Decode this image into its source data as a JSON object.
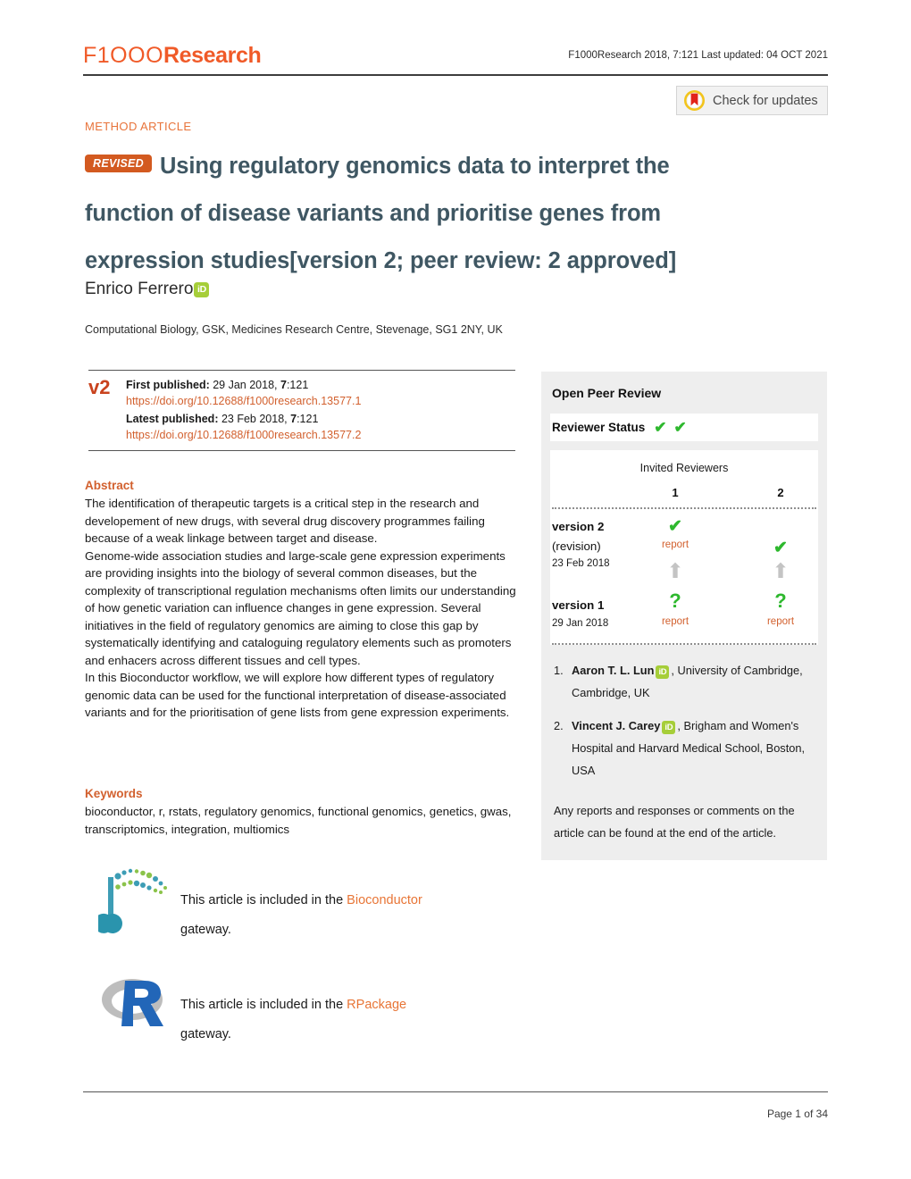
{
  "header": {
    "logo_f1000": "F1OOO",
    "logo_research": "Research",
    "citation": "F1000Research 2018, 7:121 Last updated: 04 OCT 2021",
    "crossmark_label": "Check for updates",
    "crossmark_icon": "crossmark-bookmark-icon"
  },
  "article": {
    "type": "METHOD ARTICLE",
    "revised_badge": "REVISED",
    "title_main": "Using regulatory genomics data to interpret the function of disease variants and prioritise genes from expression studies",
    "title_version": "[version 2; peer review: 2 approved]",
    "author": "Enrico Ferrero",
    "orcid_label": "iD",
    "affiliation": "Computational Biology, GSK, Medicines Research Centre, Stevenage, SG1 2NY, UK"
  },
  "publication": {
    "version_tag": "v2",
    "first_published_label": "First published:",
    "first_published_value": " 29 Jan 2018, ",
    "first_published_vol": "7",
    "first_published_page": ":121",
    "first_doi": "https://doi.org/10.12688/f1000research.13577.1",
    "latest_published_label": "Latest published:",
    "latest_published_value": " 23 Feb 2018, ",
    "latest_published_vol": "7",
    "latest_published_page": ":121",
    "latest_doi": "https://doi.org/10.12688/f1000research.13577.2"
  },
  "abstract": {
    "heading": "Abstract",
    "paragraphs": [
      "The identification of therapeutic targets is a critical step in the research and developement of new drugs, with several drug discovery programmes failing because of a weak linkage between target and disease.",
      "Genome-wide association studies and large-scale gene expression experiments are providing insights into the biology of several common diseases, but the complexity of transcriptional regulation mechanisms often limits our understanding of how genetic variation can influence changes in gene expression. Several initiatives in the field of regulatory genomics are aiming to close this gap by systematically identifying and cataloguing regulatory elements such as promoters and enhacers across different tissues and cell types.",
      "In this Bioconductor workflow, we will explore how different types of regulatory genomic data can be used for the functional interpretation of disease-associated variants and for the prioritisation of gene lists from gene expression experiments."
    ]
  },
  "keywords": {
    "heading": "Keywords",
    "text": "bioconductor, r, rstats, regulatory genomics, functional genomics, genetics, gwas, transcriptomics, integration, multiomics"
  },
  "peer_review": {
    "panel_title": "Open Peer Review",
    "status_label": "Reviewer Status",
    "status_ticks": [
      "✔",
      "✔"
    ],
    "invited_label": "Invited Reviewers",
    "columns": [
      "1",
      "2"
    ],
    "versions": [
      {
        "label": "version 2",
        "sub": "(revision)",
        "date": "23 Feb 2018"
      },
      {
        "label": "version 1",
        "sub": "",
        "date": "29 Jan 2018"
      }
    ],
    "cells": {
      "v2_r1_status": "✔",
      "v2_r1_report": "report",
      "v2_r2_status": "✔",
      "v1_r1_status": "?",
      "v1_r1_report": "report",
      "v1_r2_status": "?",
      "v1_r2_report": "report"
    },
    "reviewers": [
      {
        "num": "1.",
        "name": "Aaron T. L. Lun",
        "orcid": "iD",
        "affiliation": ", University of Cambridge, Cambridge, UK"
      },
      {
        "num": "2.",
        "name": "Vincent J. Carey",
        "orcid": "iD",
        "affiliation": ", Brigham and Women's Hospital and Harvard Medical School, Boston, USA"
      }
    ],
    "note": "Any reports and responses or comments on the article can be found at the end of the article."
  },
  "gateways": [
    {
      "icon": "bioconductor-dna-icon",
      "prefix": "This article is included in the ",
      "link": "Bioconductor",
      "suffix": "gateway."
    },
    {
      "icon": "r-logo-icon",
      "prefix": "This article is included in the ",
      "link": "RPackage",
      "suffix": "gateway."
    }
  ],
  "footer": {
    "page_label": "Page 1 of 34"
  },
  "colors": {
    "brand_orange": "#f05a28",
    "title_slate": "#3f5763",
    "link_orange": "#d2602e",
    "tick_green": "#2eb82e",
    "orcid_green": "#a6ce39",
    "panel_gray": "#eeeeee"
  }
}
